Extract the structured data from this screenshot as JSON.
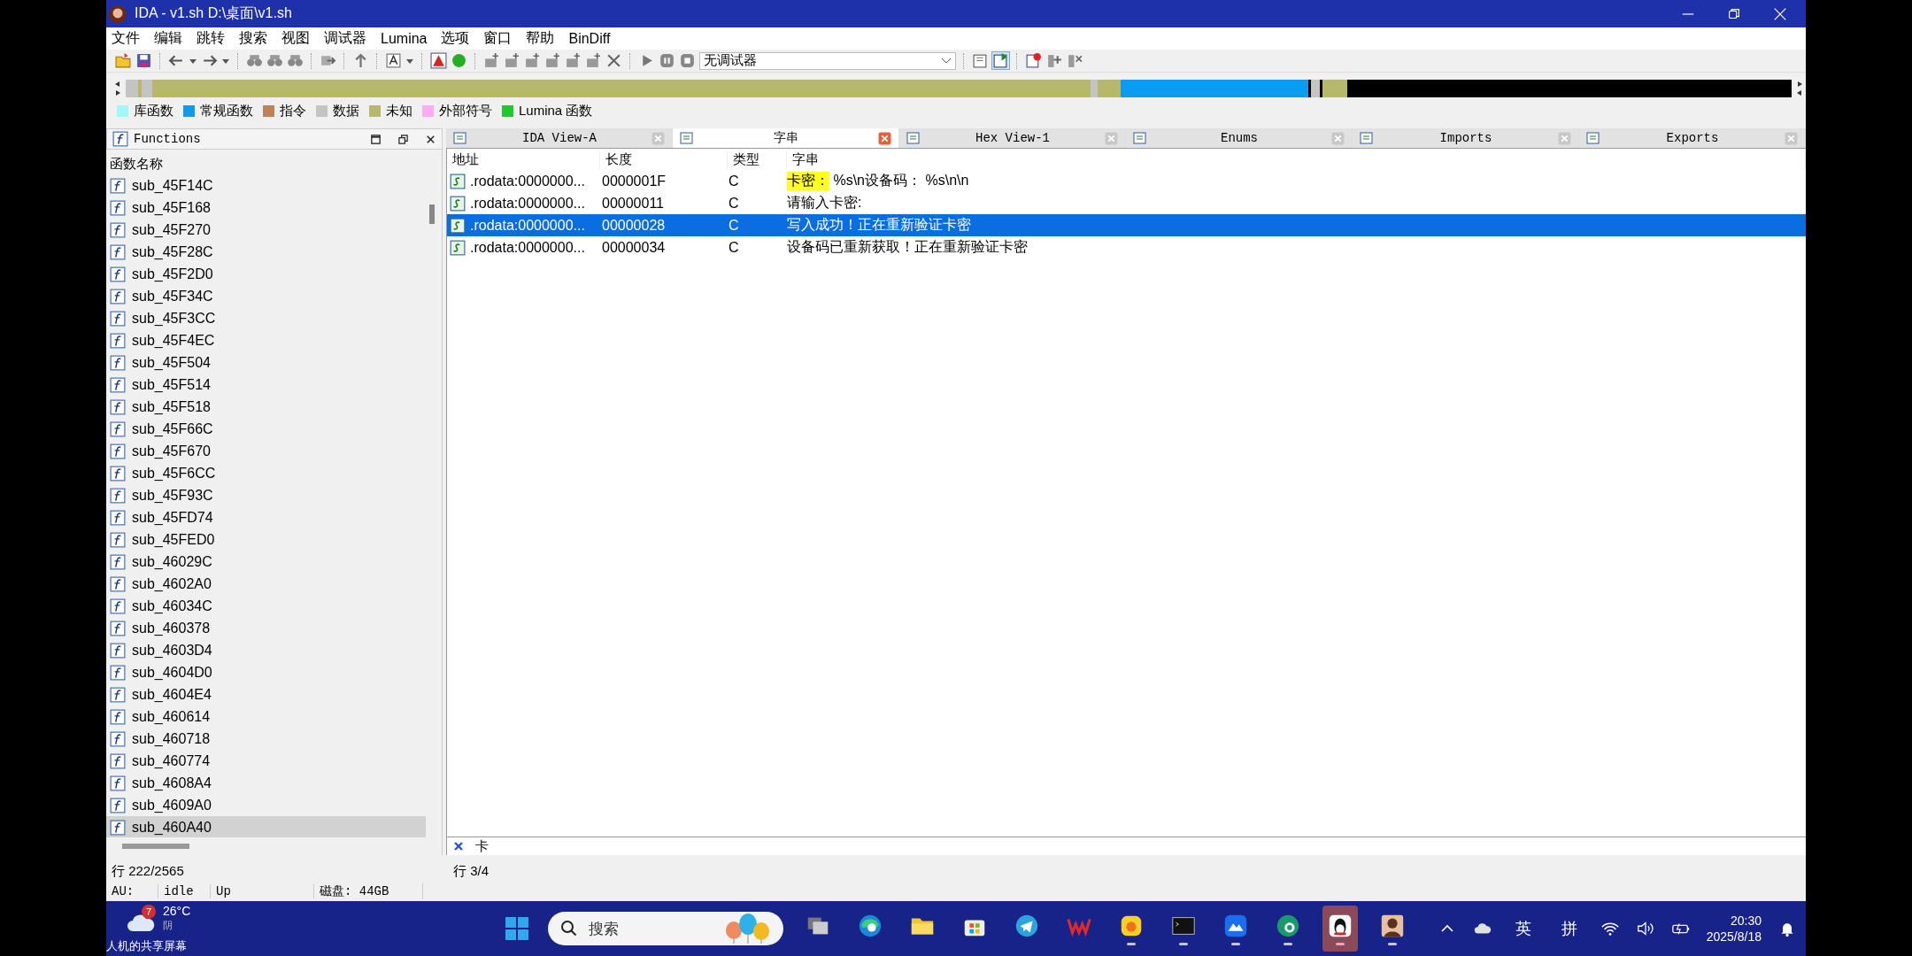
{
  "window": {
    "title": "IDA - v1.sh D:\\桌面\\v1.sh"
  },
  "menu": [
    "文件",
    "编辑",
    "跳转",
    "搜索",
    "视图",
    "调试器",
    "Lumina",
    "选项",
    "窗口",
    "帮助",
    "BinDiff"
  ],
  "toolbar": {
    "debugger": "无调试器"
  },
  "legend": [
    {
      "label": "库函数",
      "color": "#a0f8f8"
    },
    {
      "label": "常规函数",
      "color": "#0a9cf0"
    },
    {
      "label": "指令",
      "color": "#c0805a"
    },
    {
      "label": "数据",
      "color": "#c4c4c4"
    },
    {
      "label": "未知",
      "color": "#b6b86c"
    },
    {
      "label": "外部符号",
      "color": "#ffaaf4"
    },
    {
      "label": "Lumina 函数",
      "color": "#20c830"
    }
  ],
  "functions_panel": {
    "title": "Functions",
    "column": "函数名称",
    "items": [
      {
        "name": "sub_45F14C",
        "selected": false
      },
      {
        "name": "sub_45F168",
        "selected": false
      },
      {
        "name": "sub_45F270",
        "selected": false
      },
      {
        "name": "sub_45F28C",
        "selected": false
      },
      {
        "name": "sub_45F2D0",
        "selected": false
      },
      {
        "name": "sub_45F34C",
        "selected": false
      },
      {
        "name": "sub_45F3CC",
        "selected": false
      },
      {
        "name": "sub_45F4EC",
        "selected": false
      },
      {
        "name": "sub_45F504",
        "selected": false
      },
      {
        "name": "sub_45F514",
        "selected": false
      },
      {
        "name": "sub_45F518",
        "selected": false
      },
      {
        "name": "sub_45F66C",
        "selected": false
      },
      {
        "name": "sub_45F670",
        "selected": false
      },
      {
        "name": "sub_45F6CC",
        "selected": false
      },
      {
        "name": "sub_45F93C",
        "selected": false
      },
      {
        "name": "sub_45FD74",
        "selected": false
      },
      {
        "name": "sub_45FED0",
        "selected": false
      },
      {
        "name": "sub_46029C",
        "selected": false
      },
      {
        "name": "sub_4602A0",
        "selected": false
      },
      {
        "name": "sub_46034C",
        "selected": false
      },
      {
        "name": "sub_460378",
        "selected": false
      },
      {
        "name": "sub_4603D4",
        "selected": false
      },
      {
        "name": "sub_4604D0",
        "selected": false
      },
      {
        "name": "sub_4604E4",
        "selected": false
      },
      {
        "name": "sub_460614",
        "selected": false
      },
      {
        "name": "sub_460718",
        "selected": false
      },
      {
        "name": "sub_460774",
        "selected": false
      },
      {
        "name": "sub_4608A4",
        "selected": false
      },
      {
        "name": "sub_4609A0",
        "selected": false
      },
      {
        "name": "sub_460A40",
        "selected": true
      }
    ],
    "status": "行 222/2565"
  },
  "tabs": [
    {
      "label": "IDA View-A",
      "selected": false
    },
    {
      "label": "字串",
      "selected": true
    },
    {
      "label": "Hex View-1",
      "selected": false
    },
    {
      "label": "Enums",
      "selected": false
    },
    {
      "label": "Imports",
      "selected": false
    },
    {
      "label": "Exports",
      "selected": false
    }
  ],
  "strings_table": {
    "columns": [
      "地址",
      "长度",
      "类型",
      "字串"
    ],
    "rows": [
      {
        "address": ".rodata:0000000...",
        "length": "0000001F",
        "type": "C",
        "match": "卡密：",
        "text": " %s\\n设备码： %s\\n\\n",
        "selected": false
      },
      {
        "address": ".rodata:0000000...",
        "length": "00000011",
        "type": "C",
        "text": "请输入卡密:",
        "selected": false
      },
      {
        "address": ".rodata:0000000...",
        "length": "00000028",
        "type": "C",
        "text": "写入成功！正在重新验证卡密",
        "selected": true
      },
      {
        "address": ".rodata:0000000...",
        "length": "00000034",
        "type": "C",
        "text": "设备码已重新获取！正在重新验证卡密",
        "selected": false
      }
    ],
    "search": "卡",
    "status": "行 3/4"
  },
  "status_bar": {
    "au": "AU:",
    "state": "idle",
    "direction": "Up",
    "disk": "磁盘: 44GB"
  },
  "taskbar": {
    "weather": {
      "badge": "7",
      "temperature": "26°C",
      "condition": "阴"
    },
    "search_placeholder": "搜索",
    "apps": [
      {
        "kind": "taskview",
        "running": false,
        "selected": false
      },
      {
        "kind": "edge",
        "running": false,
        "selected": false
      },
      {
        "kind": "folder",
        "running": false,
        "selected": false
      },
      {
        "kind": "store",
        "running": false,
        "selected": false
      },
      {
        "kind": "telegram",
        "running": false,
        "selected": false
      },
      {
        "kind": "wps",
        "running": false,
        "selected": false
      },
      {
        "kind": "yellow",
        "running": true,
        "selected": false
      },
      {
        "kind": "terminal",
        "running": true,
        "selected": false
      },
      {
        "kind": "cloud",
        "running": true,
        "selected": false
      },
      {
        "kind": "green",
        "running": true,
        "selected": false
      },
      {
        "kind": "penguin",
        "running": true,
        "selected": true
      },
      {
        "kind": "person",
        "running": true,
        "selected": false
      }
    ],
    "ime_lang": "英",
    "ime_mode": "拼",
    "time": "20:30",
    "date": "2025/8/18"
  },
  "overlay_caption": "人机的共享屏幕"
}
